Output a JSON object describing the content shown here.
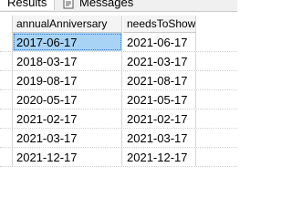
{
  "tabs": {
    "results_label": "Results",
    "messages_label": "Messages"
  },
  "grid": {
    "columns": [
      "annualAnniversary",
      "needsToShow"
    ],
    "rows": [
      [
        "2017-06-17",
        "2021-06-17"
      ],
      [
        "2018-03-17",
        "2021-03-17"
      ],
      [
        "2019-08-17",
        "2021-08-17"
      ],
      [
        "2020-05-17",
        "2021-05-17"
      ],
      [
        "2021-02-17",
        "2021-02-17"
      ],
      [
        "2021-03-17",
        "2021-03-17"
      ],
      [
        "2021-12-17",
        "2021-12-17"
      ]
    ],
    "selected_cell": "row 1, column annualAnniversary"
  },
  "colors": {
    "selection": "#a8d3f5",
    "grid_line": "#d6d6d6",
    "header_bg": "#f4f4f4"
  },
  "icons": {
    "messages": "message-icon"
  }
}
